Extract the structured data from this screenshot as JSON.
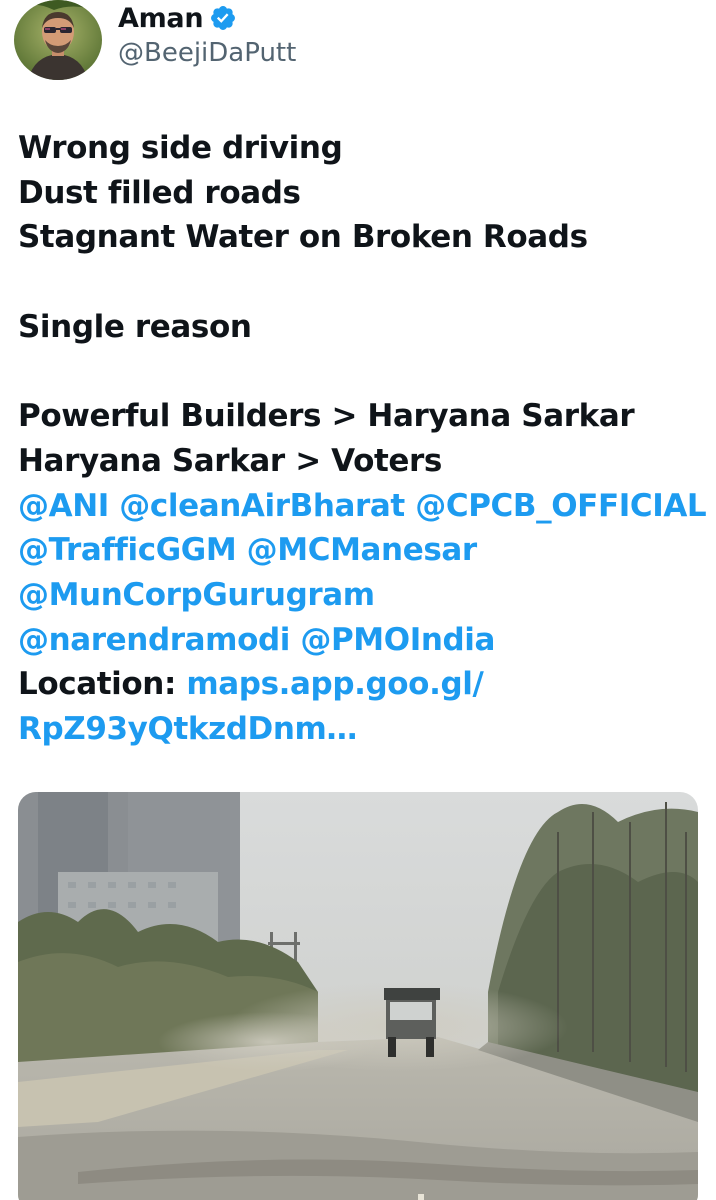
{
  "author": {
    "display_name": "Aman",
    "handle": "@BeejiDaPutt",
    "verified": true,
    "verified_icon": "verified-badge-icon",
    "verified_color": "#1d9bf0"
  },
  "tweet": {
    "line1": "Wrong side driving",
    "line2": "Dust filled roads",
    "line3": "Stagnant Water on Broken Roads",
    "line4": "Single reason",
    "line5": "Powerful Builders > Haryana Sarkar",
    "line6": "Haryana Sarkar > Voters",
    "mentions": {
      "ani": "@ANI",
      "cleanairbharat": "@cleanAirBharat",
      "cpcb": "@CPCB_OFFICIAL",
      "trafficggm": "@TrafficGGM",
      "mcmanesar": "@MCManesar",
      "muncorp": "@MunCorpGurugram",
      "narendramodi": "@narendramodi",
      "pmoindia": "@PMOIndia"
    },
    "location_label": "Location:",
    "location_link_1": "maps.app.goo.gl/",
    "location_link_2": "RpZ93yQtkzdDnm…"
  },
  "colors": {
    "text": "#0f1419",
    "secondary": "#536471",
    "link": "#1d9bf0"
  }
}
